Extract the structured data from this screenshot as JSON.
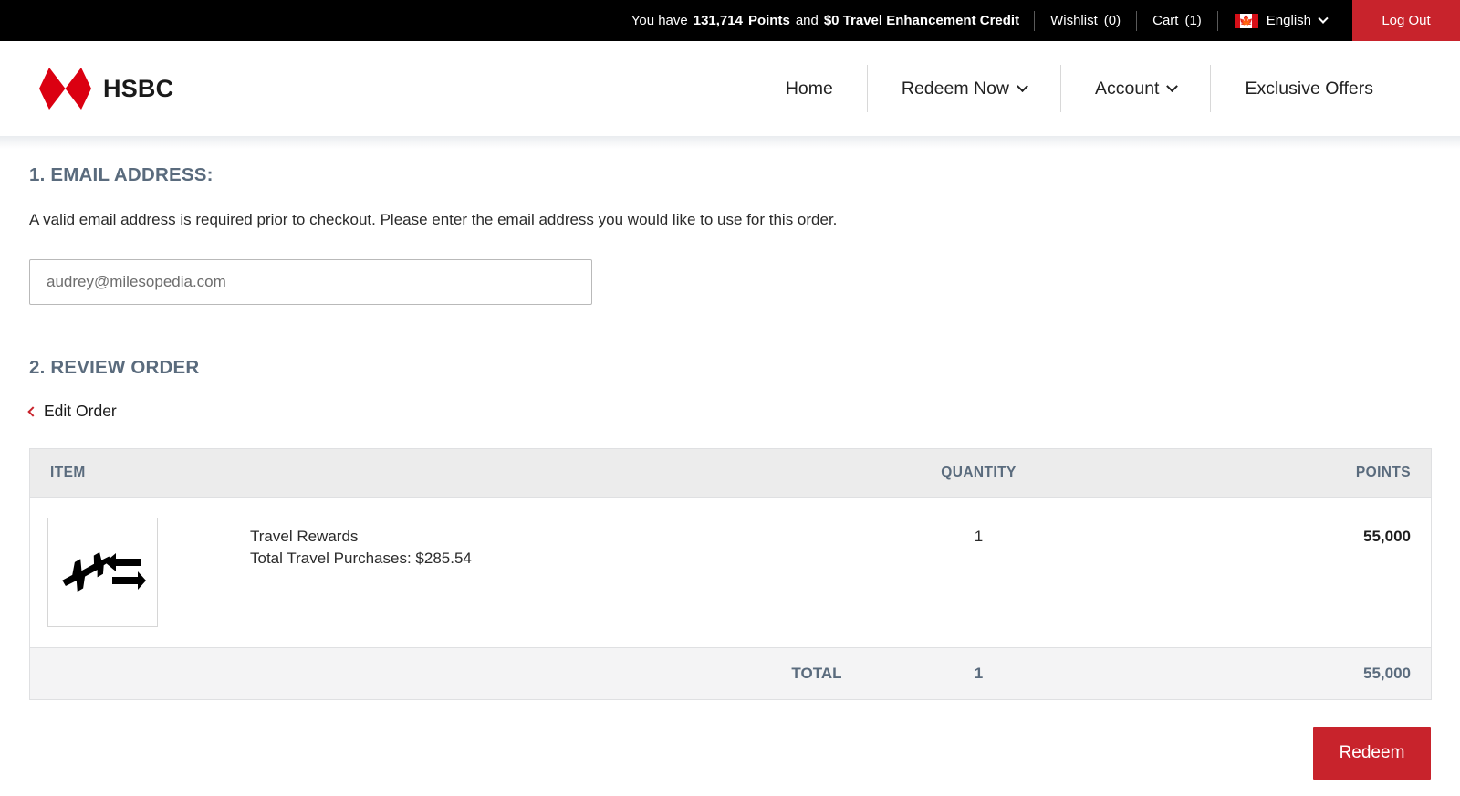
{
  "topbar": {
    "points_prefix": "You have",
    "points_value": "131,714",
    "points_word": "Points",
    "and_word": "and",
    "credit_text": "$0 Travel Enhancement Credit",
    "wishlist_label": "Wishlist",
    "wishlist_count": "(0)",
    "cart_label": "Cart",
    "cart_count": "(1)",
    "flag_icon": "canada-flag-icon",
    "flag_glyph": "█",
    "language": "English",
    "language_caret_icon": "chevron-down-icon",
    "logout_label": "Log Out",
    "background_color": "#000000",
    "accent_color": "#c8232c"
  },
  "header": {
    "logo_text": "HSBC",
    "logo_icon": "hsbc-hexagon-icon",
    "logo_color": "#db0011",
    "nav": [
      {
        "label": "Home",
        "has_caret": false
      },
      {
        "label": "Redeem Now",
        "has_caret": true
      },
      {
        "label": "Account",
        "has_caret": true
      },
      {
        "label": "Exclusive Offers",
        "has_caret": false
      }
    ]
  },
  "email_section": {
    "title": "1. EMAIL ADDRESS:",
    "help_text": "A valid email address is required prior to checkout. Please enter the email address you would like to use for this order.",
    "input_value": "audrey@milesopedia.com",
    "input_placeholder": "audrey@milesopedia.com"
  },
  "review_section": {
    "title": "2. REVIEW ORDER",
    "edit_order_label": "Edit Order",
    "edit_order_icon": "chevron-left-icon",
    "columns": {
      "item": "ITEM",
      "quantity": "QUANTITY",
      "points": "POINTS"
    },
    "rows": [
      {
        "thumb_icon": "airplane-exchange-icon",
        "name": "Travel Rewards",
        "detail": "Total Travel Purchases: $285.54",
        "quantity": "1",
        "points": "55,000"
      }
    ],
    "total": {
      "label": "TOTAL",
      "quantity": "1",
      "points": "55,000"
    }
  },
  "actions": {
    "redeem_label": "Redeem"
  }
}
